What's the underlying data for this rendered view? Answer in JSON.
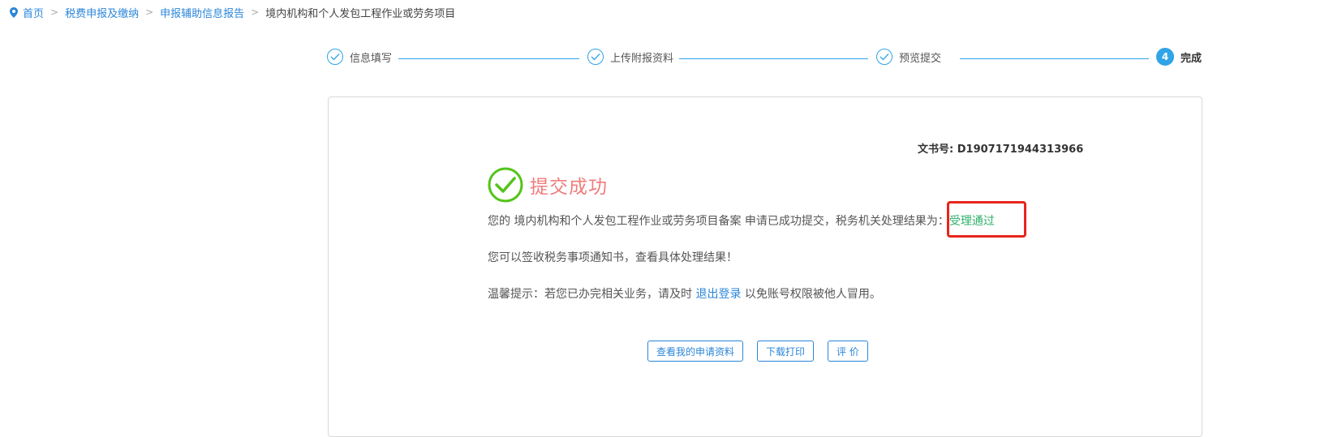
{
  "breadcrumb": {
    "items": [
      "首页",
      "税费申报及缴纳",
      "申报辅助信息报告"
    ],
    "current": "境内机构和个人发包工程作业或劳务项目",
    "separator": ">"
  },
  "steps": [
    {
      "label": "信息填写",
      "state": "done",
      "icon": "check-icon"
    },
    {
      "label": "上传附报资料",
      "state": "done",
      "icon": "check-icon"
    },
    {
      "label": "预览提交",
      "state": "done",
      "icon": "check-icon"
    },
    {
      "number": "4",
      "label": "完成",
      "state": "active"
    }
  ],
  "result": {
    "doc_no_label": "文书号:",
    "doc_no": "D1907171944313966",
    "title": "提交成功",
    "line1_prefix": "您的 境内机构和个人发包工程作业或劳务项目备案 申请已成功提交，税务机关处理结果为：",
    "status": "受理通过",
    "line2": "您可以签收税务事项通知书，查看具体处理结果！",
    "line3_prefix": "温馨提示：若您已办完相关业务，请及时 ",
    "logout_link": "退出登录",
    "line3_suffix": " 以免账号权限被他人冒用。"
  },
  "buttons": {
    "view": "查看我的申请资料",
    "download": "下载打印",
    "rate": "评 价"
  },
  "colors": {
    "accent": "#2fa4e7",
    "link": "#2b86d9",
    "success_icon": "#52c41a",
    "success_title": "#f07c7c",
    "status_green": "#2fb06a",
    "highlight_red": "#e8241c"
  }
}
